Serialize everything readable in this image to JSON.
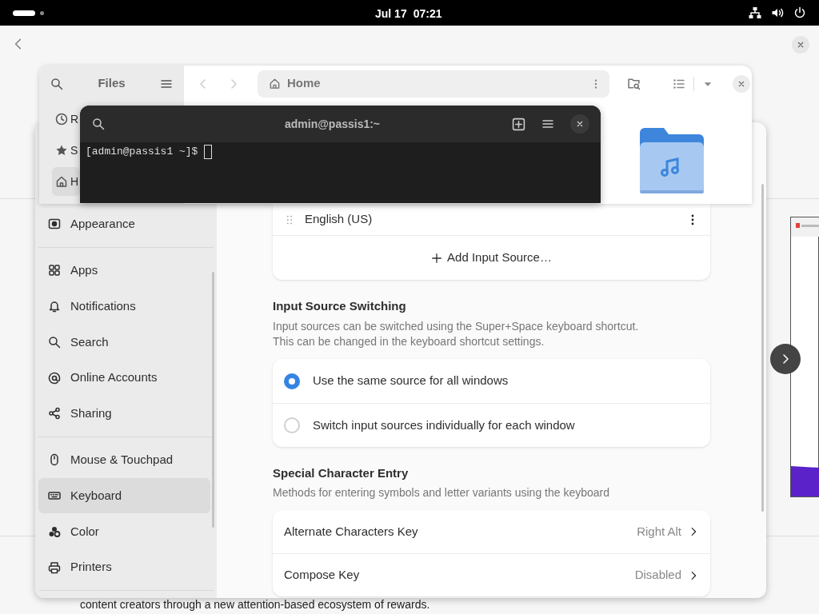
{
  "top_bar": {
    "date": "Jul 17",
    "time": "07:21"
  },
  "background_page": {
    "footer_text": "content creators through a new attention-based ecosystem of rewards."
  },
  "files_window": {
    "title": "Files",
    "path": "Home",
    "sidebar_items": [
      {
        "label": "R",
        "selected": false
      },
      {
        "label": "S",
        "selected": false
      },
      {
        "label": "H",
        "selected": true
      }
    ]
  },
  "terminal": {
    "title": "admin@passis1:~",
    "prompt": "[admin@passis1 ~]$"
  },
  "settings": {
    "sidebar_groups": [
      {
        "items": [
          {
            "label": "Appearance",
            "selected": false
          }
        ]
      },
      {
        "items": [
          {
            "label": "Apps",
            "selected": false
          },
          {
            "label": "Notifications",
            "selected": false
          },
          {
            "label": "Search",
            "selected": false
          },
          {
            "label": "Online Accounts",
            "selected": false
          },
          {
            "label": "Sharing",
            "selected": false
          }
        ]
      },
      {
        "items": [
          {
            "label": "Mouse & Touchpad",
            "selected": false
          },
          {
            "label": "Keyboard",
            "selected": true
          },
          {
            "label": "Color",
            "selected": false
          },
          {
            "label": "Printers",
            "selected": false
          }
        ]
      }
    ],
    "input_sources": [
      {
        "label": "English (US)"
      }
    ],
    "add_button": "Add Input Source…",
    "switching": {
      "heading": "Input Source Switching",
      "description_lines": [
        "Input sources can be switched using the Super+Space keyboard shortcut.",
        "This can be changed in the keyboard shortcut settings."
      ],
      "options": [
        {
          "label": "Use the same source for all windows",
          "selected": true
        },
        {
          "label": "Switch input sources individually for each window",
          "selected": false
        }
      ]
    },
    "special": {
      "heading": "Special Character Entry",
      "description": "Methods for entering symbols and letter variants using the keyboard",
      "rows": [
        {
          "label": "Alternate Characters Key",
          "value": "Right Alt"
        },
        {
          "label": "Compose Key",
          "value": "Disabled"
        }
      ]
    }
  }
}
